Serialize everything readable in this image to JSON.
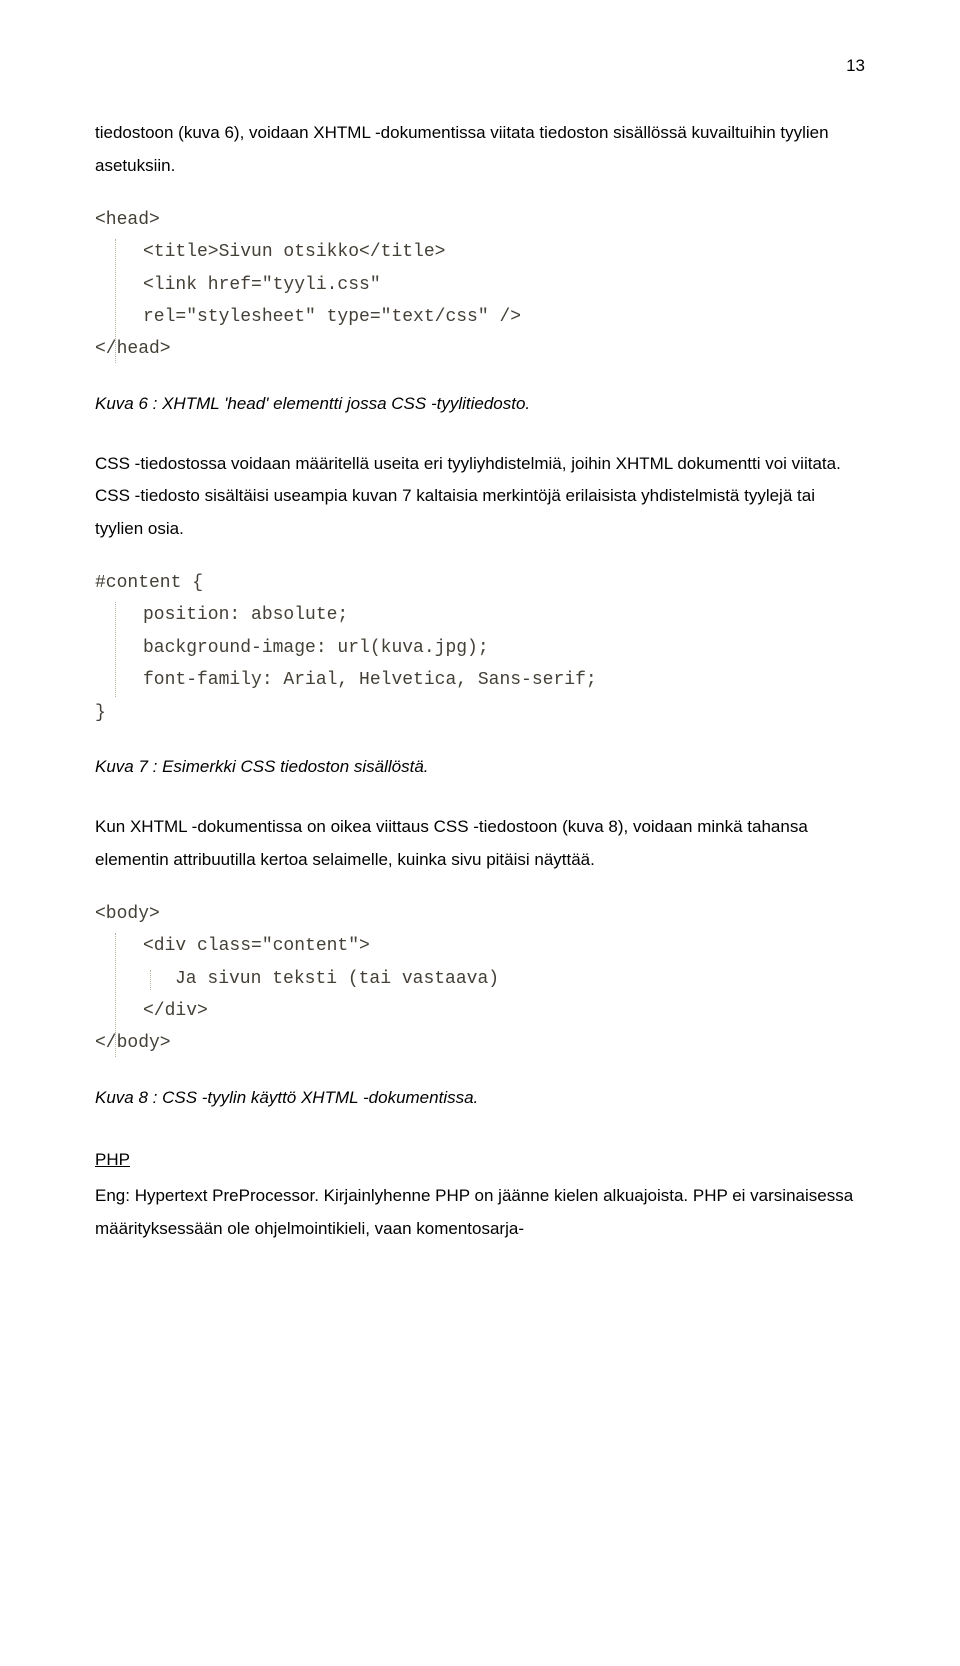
{
  "page_number": "13",
  "para1": "tiedostoon (kuva 6), voidaan XHTML -dokumentissa viitata tiedoston sisällössä kuvailtuihin tyylien asetuksiin.",
  "code_head": {
    "l1": "<head>",
    "l2": "<title>Sivun otsikko</title>",
    "l3": "<link href=\"tyyli.css\"",
    "l4": "rel=\"stylesheet\" type=\"text/css\" />",
    "l5": "</head>"
  },
  "caption1": "Kuva 6 : XHTML 'head' elementti jossa CSS -tyylitiedosto.",
  "para2": "CSS -tiedostossa voidaan määritellä useita eri tyyliyhdistelmiä, joihin XHTML dokumentti voi viitata. CSS -tiedosto sisältäisi useampia kuvan 7 kaltaisia merkintöjä erilaisista yhdistelmistä tyylejä tai tyylien osia.",
  "code_css": {
    "l1": "#content {",
    "l2": "position: absolute;",
    "l3": "background-image: url(kuva.jpg);",
    "l4": "font-family: Arial, Helvetica, Sans-serif;",
    "l5": "}"
  },
  "caption2": "Kuva 7 : Esimerkki CSS tiedoston sisällöstä.",
  "para3": "Kun XHTML -dokumentissa on oikea viittaus CSS -tiedostoon (kuva 8), voidaan minkä tahansa elementin attribuutilla kertoa selaimelle, kuinka sivu pitäisi näyttää.",
  "code_body": {
    "l1": "<body>",
    "l2": "<div class=\"content\">",
    "l3": "Ja sivun teksti (tai vastaava)",
    "l4": "</div>",
    "l5": "</body>"
  },
  "caption3": "Kuva 8 : CSS -tyylin käyttö XHTML -dokumentissa.",
  "php_heading": "PHP",
  "php_para": "Eng: Hypertext PreProcessor. Kirjainlyhenne PHP on jäänne kielen alkuajoista. PHP ei varsinaisessa määrityksessään ole ohjelmointikieli, vaan komentosarja-"
}
